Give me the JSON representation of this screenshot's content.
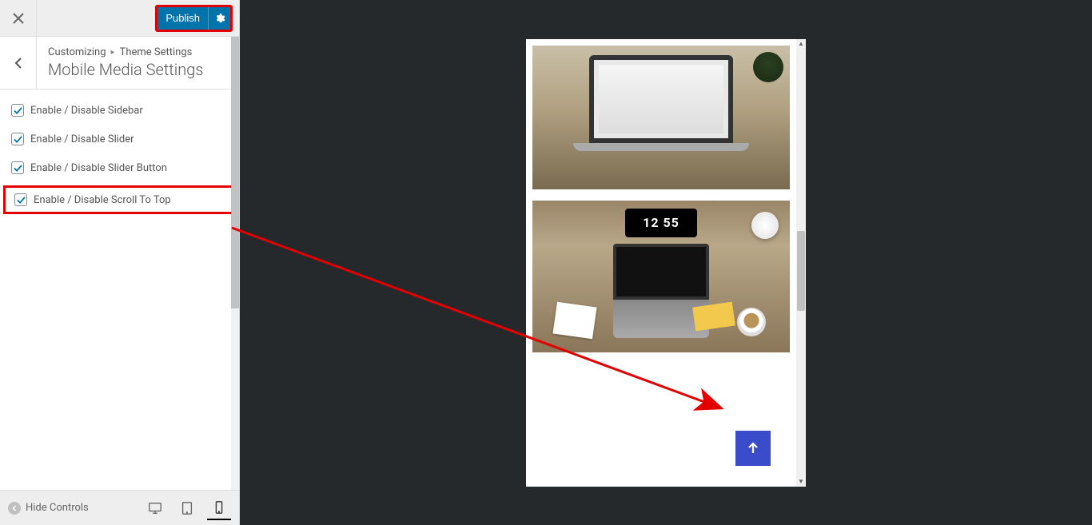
{
  "topbar": {
    "publish_label": "Publish"
  },
  "header": {
    "breadcrumb_root": "Customizing",
    "breadcrumb_parent": "Theme Settings",
    "section_title": "Mobile Media Settings"
  },
  "controls": [
    {
      "label": "Enable / Disable Sidebar",
      "checked": true,
      "highlight": false
    },
    {
      "label": "Enable / Disable Slider",
      "checked": true,
      "highlight": false
    },
    {
      "label": "Enable / Disable Slider Button",
      "checked": true,
      "highlight": false
    },
    {
      "label": "Enable / Disable Scroll To Top",
      "checked": true,
      "highlight": true
    }
  ],
  "footer": {
    "hide_controls_label": "Hide Controls"
  },
  "preview": {
    "clock_time": "12 55"
  },
  "colors": {
    "accent": "#0073aa",
    "scroll_top": "#3b4cca",
    "highlight": "#e30000"
  }
}
